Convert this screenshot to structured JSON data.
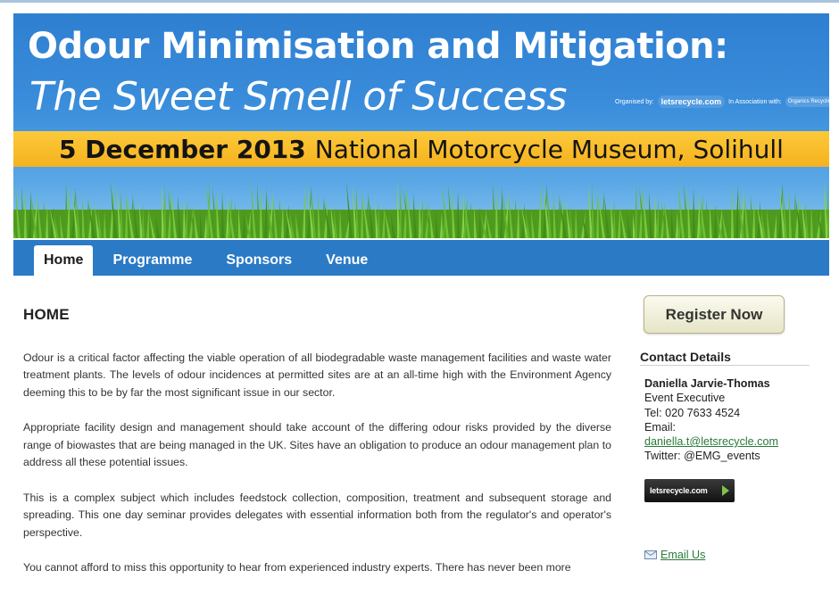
{
  "banner": {
    "title": "Odour Minimisation and Mitigation:",
    "subtitle": "The Sweet Smell of Success",
    "organised_by": "Organised by:",
    "organiser_logo": "letsrecycle.com",
    "in_association": "In Association with:",
    "partner_logo": "Organics Recycling Group",
    "date": "5 December 2013",
    "venue": "National Motorcycle Museum, Solihull"
  },
  "nav": {
    "tabs": [
      {
        "label": "Home"
      },
      {
        "label": "Programme"
      },
      {
        "label": "Sponsors"
      },
      {
        "label": "Venue"
      }
    ]
  },
  "main": {
    "title": "HOME",
    "paragraphs": [
      "Odour is a critical factor affecting the viable operation of all biodegradable waste management facilities and waste water treatment plants. The levels of odour incidences at permitted sites are at an all-time high with the Environment Agency deeming this to be by far the most significant issue in our sector.",
      "Appropriate facility design and management should take account of the differing odour risks provided by the diverse range of biowastes that are being managed in the UK. Sites have an obligation to produce an odour management plan to address all these potential issues.",
      "This is a complex subject which includes feedstock collection, composition, treatment and subsequent storage and spreading. This one day seminar provides delegates with essential information both from the regulator's and operator's perspective.",
      "You cannot afford to miss this opportunity to hear from experienced industry experts. There has never been more"
    ]
  },
  "sidebar": {
    "register_label": "Register Now",
    "contact_heading": "Contact Details",
    "contact_name": "Daniella Jarvie-Thomas",
    "contact_role": "Event Executive",
    "contact_tel": "Tel: 020 7633 4524",
    "contact_email_label": "Email:",
    "contact_email": "daniella.t@letsrecycle.com",
    "contact_twitter": "Twitter: @EMG_events",
    "badge_text": "letsrecycle.com",
    "email_us_label": "Email Us"
  },
  "colors": {
    "banner_blue": "#2f7fd1",
    "strip_yellow": "#f6b21e",
    "nav_blue": "#2a7ac6",
    "link_green": "#2a7a3a"
  },
  "icons": [
    "envelope-icon",
    "arrow-right-icon"
  ]
}
